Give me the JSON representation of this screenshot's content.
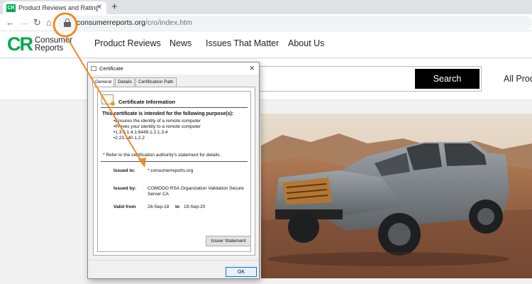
{
  "browser": {
    "tab_title": "Product Reviews and Ratings - C",
    "tab_favicon_text": "CR",
    "url_domain": "consumerreports.org",
    "url_path": "/cro/index.htm"
  },
  "site": {
    "logo_mark": "CR",
    "logo_line1": "Consumer",
    "logo_line2": "Reports",
    "brand_color": "#00a94f",
    "nav": [
      "Product Reviews",
      "News",
      "Issues That Matter",
      "About Us"
    ],
    "search_button": "Search",
    "all_products": "All Prod"
  },
  "certificate": {
    "window_title": "Certificate",
    "tabs": [
      "General",
      "Details",
      "Certification Path"
    ],
    "info_heading": "Certificate Information",
    "purpose_heading": "This certificate is intended for the following purpose(s):",
    "purposes": [
      "Ensures the identity of a remote computer",
      "Proves your identity to a remote computer",
      "1.3.6.1.4.1.6449.1.2.1.3.4",
      "2.23.140.1.2.2"
    ],
    "ref_note": "* Refer to the certification authority's statement for details.",
    "issued_to_label": "Issued to:",
    "issued_to": "*.consumerreports.org",
    "issued_by_label": "Issued by:",
    "issued_by": "COMODO RSA Organization Validation Secure Server CA",
    "valid_from_label": "Valid from",
    "valid_from": "26-Sep-18",
    "valid_to_label": "to",
    "valid_to": "19-Sep-20",
    "issuer_statement_button": "Issuer Statement",
    "ok_button": "OK"
  },
  "annotation": {
    "color": "#f08a24"
  }
}
